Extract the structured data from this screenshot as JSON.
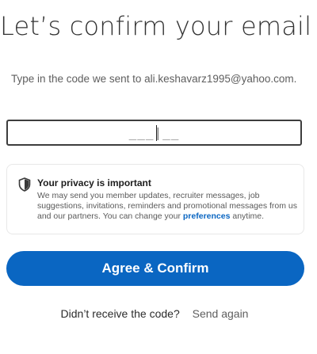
{
  "page": {
    "title": "Let’s confirm your email",
    "instructions": "Type in the code we sent to ali.keshavarz1995@yahoo.com."
  },
  "code_input": {
    "value": "",
    "placeholder": "___|__"
  },
  "privacy": {
    "icon": "shield-icon",
    "heading": "Your privacy is important",
    "body_before_link": "We may send you member updates, recruiter messages, job suggestions, invitations, reminders and promotional messages from us and our partners. You can change your ",
    "link_label": "preferences",
    "body_after_link": " anytime."
  },
  "actions": {
    "agree_label": "Agree & Confirm",
    "resend_question": "Didn’t receive the code?",
    "resend_label": "Send again"
  },
  "colors": {
    "accent": "#0a66c2",
    "title": "#333333",
    "muted_text": "#5e5e5e",
    "input_border": "#3d3d3d"
  }
}
